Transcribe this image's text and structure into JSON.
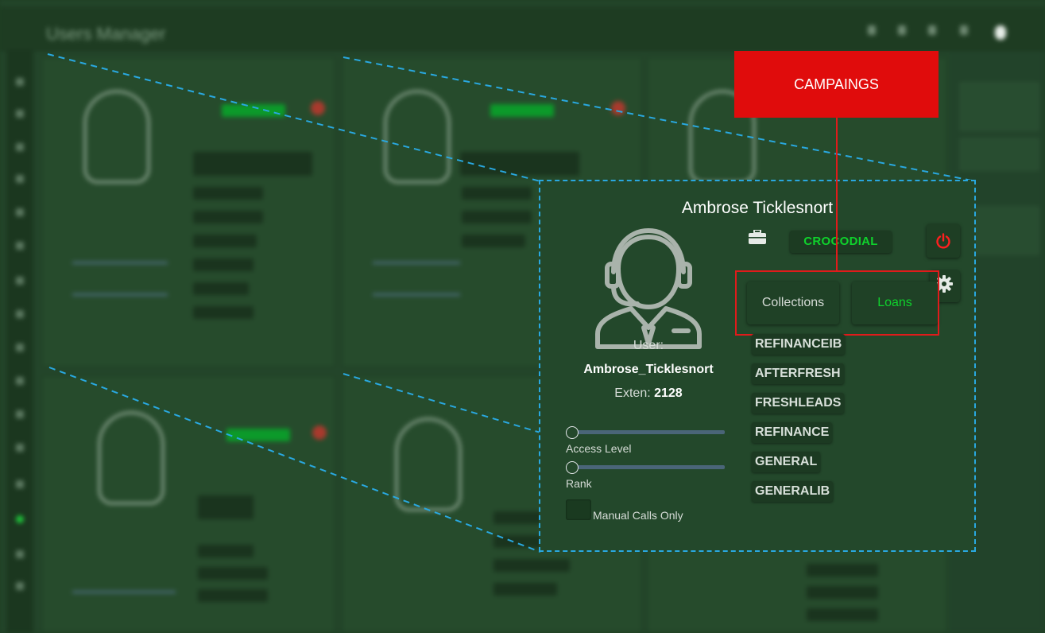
{
  "app": {
    "title": "Users Manager"
  },
  "callout": {
    "label": "CAMPAINGS"
  },
  "card": {
    "title": "Ambrose Ticklesnort",
    "user_caption": "User:",
    "login": "Ambrose_Ticklesnort",
    "exten_label": "Exten:",
    "exten_value": "2128",
    "access_level_label": "Access Level",
    "access_level_value": 0,
    "rank_label": "Rank",
    "rank_value": 0,
    "manual_calls_label": "Manual Calls Only",
    "campaign_badge": "CROCODIAL",
    "tabs": [
      {
        "label": "Collections",
        "active": false
      },
      {
        "label": "Loans",
        "active": true
      }
    ],
    "campaigns": [
      "REFINANCEIB",
      "AFTERFRESH",
      "FRESHLEADS",
      "REFINANCE",
      "GENERAL",
      "GENERALIB"
    ]
  },
  "icons": {
    "avatar": "headset-agent-icon",
    "briefcase": "briefcase-icon",
    "power": "power-icon",
    "settings": "gear-icon"
  },
  "colors": {
    "background": "#23482b",
    "accent_green": "#0fd22c",
    "danger_red": "#e00c0c",
    "guide_blue": "#29a8e0"
  }
}
